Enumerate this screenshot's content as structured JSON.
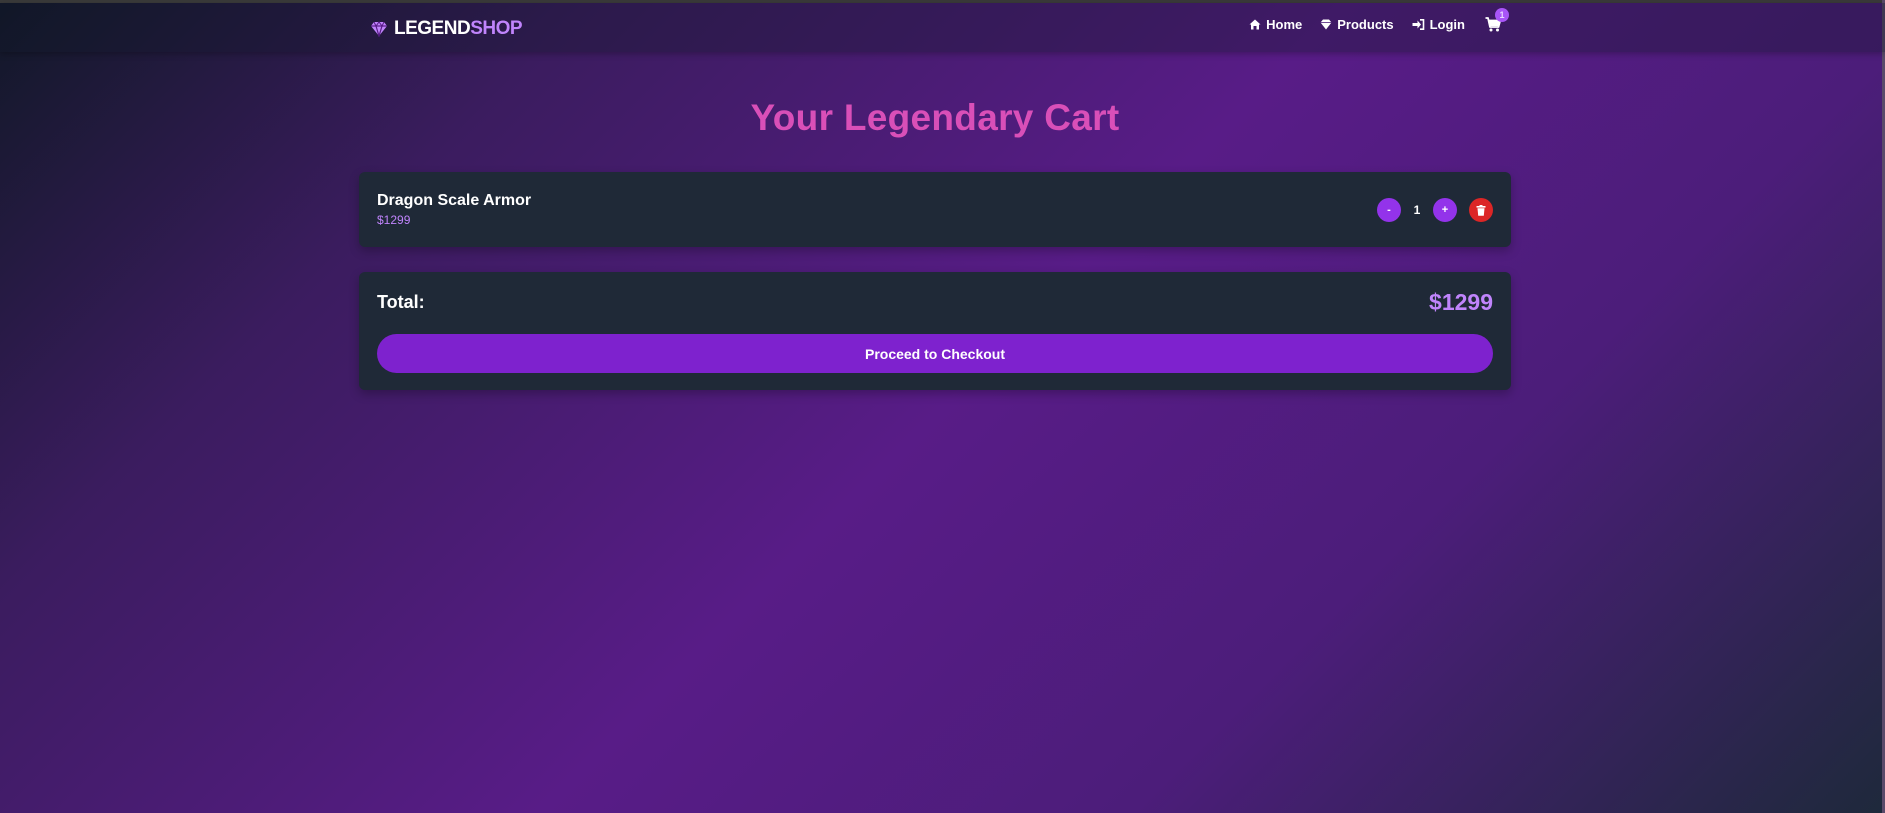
{
  "brand": {
    "name_part1": "LEGEND",
    "name_part2": "SHOP",
    "icon": "gem-icon"
  },
  "nav": {
    "links": [
      {
        "label": "Home",
        "icon": "home-icon"
      },
      {
        "label": "Products",
        "icon": "gem-icon"
      },
      {
        "label": "Login",
        "icon": "sign-in-icon"
      }
    ],
    "cart": {
      "icon": "cart-icon",
      "count": "1"
    }
  },
  "page": {
    "title": "Your Legendary Cart"
  },
  "cart": {
    "items": [
      {
        "name": "Dragon Scale Armor",
        "price": "$1299",
        "quantity": "1",
        "decrement_label": "-",
        "increment_label": "+"
      }
    ]
  },
  "summary": {
    "total_label": "Total:",
    "total_value": "$1299",
    "checkout_label": "Proceed to Checkout"
  },
  "colors": {
    "accent": "#c084fc",
    "title": "#d94fb8",
    "button": "#7e22ce",
    "delete": "#dc2626",
    "panel": "#1f2937"
  }
}
